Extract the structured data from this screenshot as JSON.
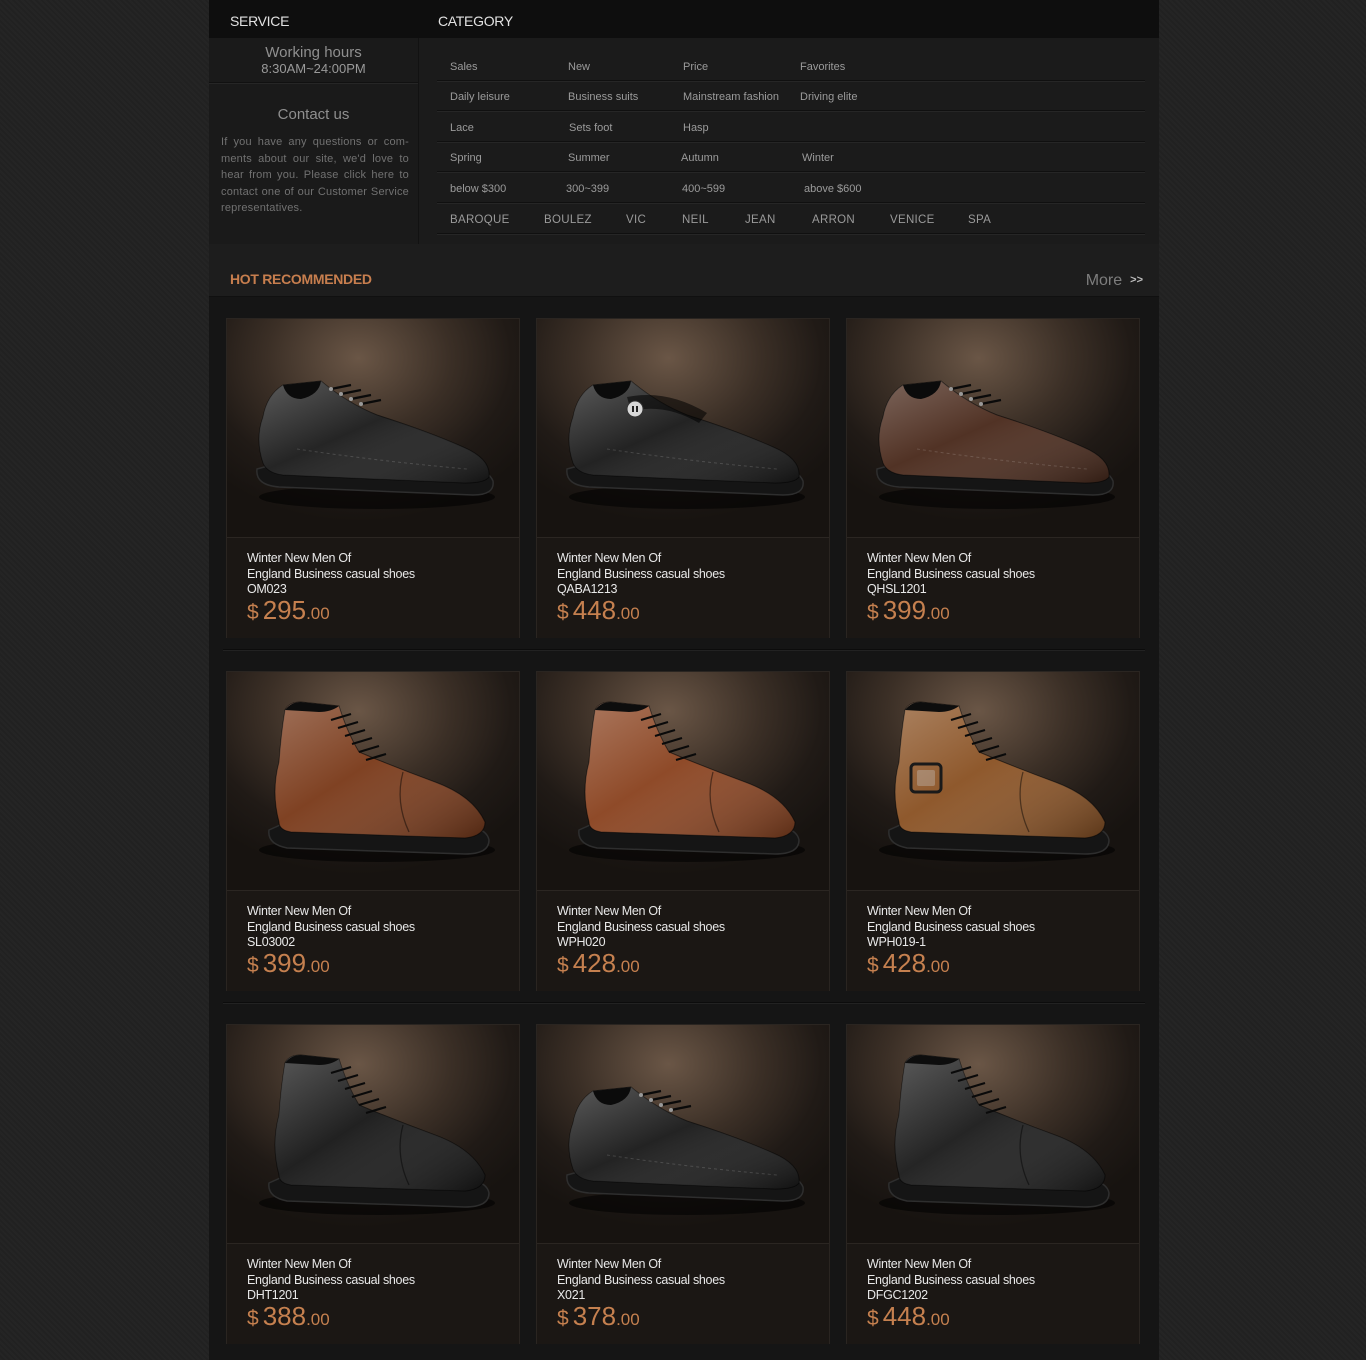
{
  "header": {
    "service_label": "SERVICE",
    "category_label": "CATEGORY"
  },
  "service": {
    "working_hours_title": "Working hours",
    "working_hours_value": "8:30AM~24:00PM",
    "contact_title": "Contact us",
    "contact_text": "If you have any questions or com-ments about our site, we'd love to hear from you. Please click here to contact one of our Customer Service representatives."
  },
  "category": {
    "rows": [
      [
        "Sales",
        "New",
        "Price",
        "Favorites"
      ],
      [
        "Daily leisure",
        "Business suits",
        "Mainstream fashion",
        "Driving elite"
      ],
      [
        "Lace",
        "Sets foot",
        "Hasp"
      ],
      [
        "Spring",
        "Summer",
        "Autumn",
        "Winter"
      ],
      [
        "below $300",
        "300~399",
        "400~599",
        "above $600"
      ]
    ],
    "brands": [
      "BAROQUE",
      "BOULEZ",
      "VIC",
      "NEIL",
      "JEAN",
      "ARRON",
      "VENICE",
      "SPA"
    ]
  },
  "section": {
    "title": "HOT RECOMMENDED",
    "more_label": "More",
    "more_arrow": ">>"
  },
  "colors": {
    "accent": "#c5804f",
    "background": "#161616",
    "text_light": "#e8e8e8"
  },
  "products": [
    {
      "line1": "Winter New Men Of",
      "line2": "England Business casual shoes",
      "code": "OM023",
      "currency": "$",
      "price_int": "295",
      "price_dec": ".00",
      "style": "loafer-lace",
      "color": "#1c1c1c",
      "icon": "black-lace-up-loafer-image"
    },
    {
      "line1": "Winter New Men Of",
      "line2": "England Business casual shoes",
      "code": "QABA1213",
      "currency": "$",
      "price_int": "448",
      "price_dec": ".00",
      "style": "loafer-strap",
      "color": "#1a1a1a",
      "icon": "black-strap-loafer-image"
    },
    {
      "line1": "Winter New Men Of",
      "line2": "England Business casual shoes",
      "code": "QHSL1201",
      "currency": "$",
      "price_int": "399",
      "price_dec": ".00",
      "style": "derby",
      "color": "#4a2a1c",
      "icon": "brown-derby-shoe-image"
    },
    {
      "line1": "Winter New Men Of",
      "line2": "England Business casual shoes",
      "code": "SL03002",
      "currency": "$",
      "price_int": "399",
      "price_dec": ".00",
      "style": "boot",
      "color": "#7a3a1a",
      "icon": "tan-chukka-boot-image"
    },
    {
      "line1": "Winter New Men Of",
      "line2": "England Business casual shoes",
      "code": "WPH020",
      "currency": "$",
      "price_int": "428",
      "price_dec": ".00",
      "style": "boot",
      "color": "#8a4320",
      "icon": "tan-lace-boot-image"
    },
    {
      "line1": "Winter New Men Of",
      "line2": "England Business casual shoes",
      "code": "WPH019-1",
      "currency": "$",
      "price_int": "428",
      "price_dec": ".00",
      "style": "boot-buckle",
      "color": "#8a5224",
      "icon": "tan-buckle-boot-image"
    },
    {
      "line1": "Winter New Men Of",
      "line2": "England Business casual shoes",
      "code": "DHT1201",
      "currency": "$",
      "price_int": "388",
      "price_dec": ".00",
      "style": "boot",
      "color": "#181818",
      "icon": "black-high-boot-image"
    },
    {
      "line1": "Winter New Men Of",
      "line2": "England Business casual shoes",
      "code": "X021",
      "currency": "$",
      "price_int": "378",
      "price_dec": ".00",
      "style": "derby",
      "color": "#1a1a1a",
      "icon": "black-derby-shoe-image"
    },
    {
      "line1": "Winter New Men Of",
      "line2": "England Business casual shoes",
      "code": "DFGC1202",
      "currency": "$",
      "price_int": "448",
      "price_dec": ".00",
      "style": "boot",
      "color": "#1c1c1c",
      "icon": "black-chukka-boot-image"
    }
  ]
}
